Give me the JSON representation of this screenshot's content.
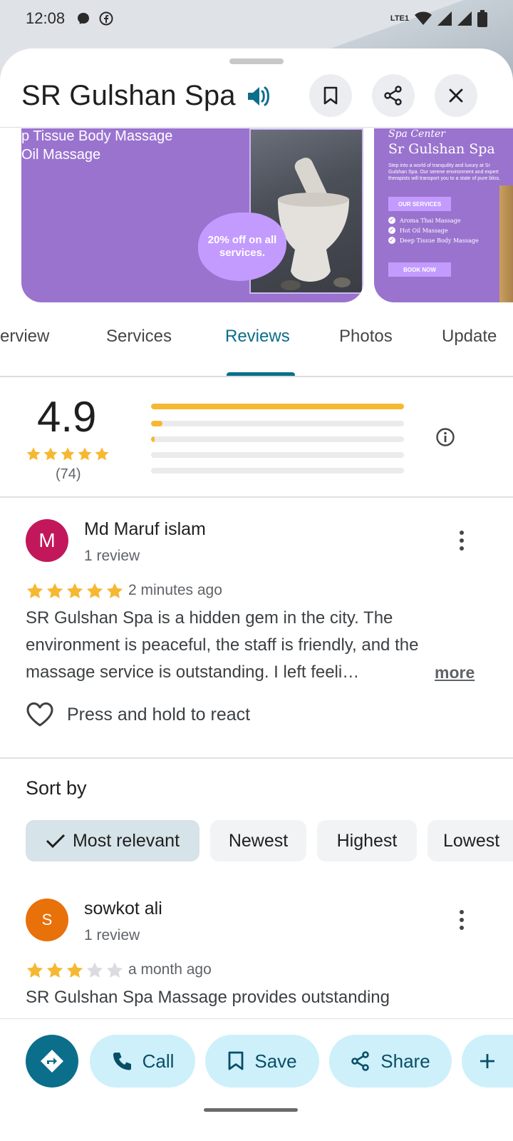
{
  "status_bar": {
    "time": "12:08",
    "network_label": "LTE1"
  },
  "place": {
    "title": "SR Gulshan Spa"
  },
  "gallery": {
    "image1_lines": [
      "p Tissue Body Massage",
      "Oil Massage"
    ],
    "image1_offer": "20% off on all services.",
    "image2_script": "Spa Center",
    "image2_title": "Sr Gulshan Spa",
    "image2_desc": "Step into a world of tranquility and luxury at Sr Gulshan Spa. Our serene environment and expert therapists will transport you to a state of pure bliss.",
    "image2_services_label": "OUR SERVICES",
    "image2_services": [
      "Aroma Thai Massage",
      "Hot Oil Massage",
      "Deep Tissue Body Massage"
    ],
    "image2_cta": "BOOK NOW"
  },
  "tabs": [
    "erview",
    "Services",
    "Reviews",
    "Photos",
    "Update"
  ],
  "active_tab": "Reviews",
  "rating_summary": {
    "rating": "4.9",
    "count": "(74)",
    "stars": 5,
    "distribution": [
      1.0,
      0.045,
      0.015,
      0.0,
      0.0
    ]
  },
  "reviews": [
    {
      "avatar_letter": "M",
      "avatar_color": "#c2185b",
      "name": "Md Maruf islam",
      "sub": "1 review",
      "stars": 5,
      "time": "2 minutes ago",
      "text": "SR Gulshan Spa is a hidden gem in the city. The environment is peaceful, the staff is friendly, and the massage service is outstanding. I left feeli…",
      "more": "more",
      "react_label": "Press and hold to react"
    },
    {
      "avatar_letter": "S",
      "avatar_color": "#e8710a",
      "name": "sowkot ali",
      "sub": "1 review",
      "stars": 3,
      "time": "a month ago",
      "text": "SR Gulshan Spa Massage provides outstanding"
    }
  ],
  "sort": {
    "title": "Sort by",
    "options": [
      "Most relevant",
      "Newest",
      "Highest",
      "Lowest"
    ],
    "selected": "Most relevant"
  },
  "actions": {
    "call": "Call",
    "save": "Save",
    "share": "Share"
  },
  "colors": {
    "accent": "#0b6e8b",
    "star": "#f6b832",
    "action_bg": "#cdf0fb"
  }
}
